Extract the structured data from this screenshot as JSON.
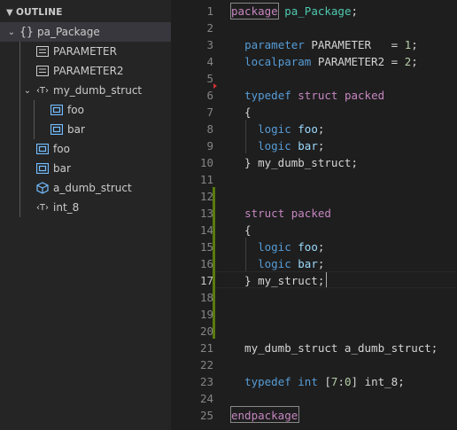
{
  "outline": {
    "title": "OUTLINE",
    "items": [
      {
        "label": "pa_Package",
        "icon": "braces-icon",
        "chevron": "expanded",
        "depth": 1,
        "selected": true
      },
      {
        "label": "PARAMETER",
        "icon": "constant-icon",
        "chevron": "none",
        "depth": 2
      },
      {
        "label": "PARAMETER2",
        "icon": "constant-icon",
        "chevron": "none",
        "depth": 2
      },
      {
        "label": "my_dumb_struct",
        "icon": "type-parameter-icon",
        "chevron": "expanded",
        "depth": 2
      },
      {
        "label": "foo",
        "icon": "variable-icon",
        "chevron": "none",
        "depth": 3
      },
      {
        "label": "bar",
        "icon": "variable-icon",
        "chevron": "none",
        "depth": 3
      },
      {
        "label": "foo",
        "icon": "variable-icon",
        "chevron": "none",
        "depth": 2
      },
      {
        "label": "bar",
        "icon": "variable-icon",
        "chevron": "none",
        "depth": 2
      },
      {
        "label": "a_dumb_struct",
        "icon": "cube-icon",
        "chevron": "none",
        "depth": 2
      },
      {
        "label": "int_8",
        "icon": "type-parameter-icon",
        "chevron": "none",
        "depth": 2
      }
    ],
    "icon_glyphs": {
      "braces": "{}",
      "type_param": "‹T›"
    }
  },
  "editor": {
    "current_line": 17,
    "lines": [
      {
        "n": "1",
        "tokens": [
          {
            "t": "package",
            "c": "kw"
          },
          {
            "t": " ",
            "c": "tx"
          },
          {
            "t": "pa_Package",
            "c": "ty"
          },
          {
            "t": ";",
            "c": "tx"
          }
        ]
      },
      {
        "n": "2",
        "tokens": []
      },
      {
        "n": "3",
        "tokens": [
          {
            "t": "  ",
            "c": "tx"
          },
          {
            "t": "parameter",
            "c": "kb"
          },
          {
            "t": " PARAMETER   = ",
            "c": "tx"
          },
          {
            "t": "1",
            "c": "nm"
          },
          {
            "t": ";",
            "c": "tx"
          }
        ]
      },
      {
        "n": "4",
        "tokens": [
          {
            "t": "  ",
            "c": "tx"
          },
          {
            "t": "localparam",
            "c": "kb"
          },
          {
            "t": " PARAMETER2 = ",
            "c": "tx"
          },
          {
            "t": "2",
            "c": "nm"
          },
          {
            "t": ";",
            "c": "tx"
          }
        ]
      },
      {
        "n": "5",
        "tokens": []
      },
      {
        "n": "6",
        "tokens": [
          {
            "t": "  ",
            "c": "tx"
          },
          {
            "t": "typedef",
            "c": "kb"
          },
          {
            "t": " ",
            "c": "tx"
          },
          {
            "t": "struct",
            "c": "kw"
          },
          {
            "t": " ",
            "c": "tx"
          },
          {
            "t": "packed",
            "c": "kw"
          }
        ]
      },
      {
        "n": "7",
        "tokens": [
          {
            "t": "  {",
            "c": "tx"
          }
        ]
      },
      {
        "n": "8",
        "tokens": [
          {
            "t": "    ",
            "c": "tx"
          },
          {
            "t": "logic",
            "c": "kb"
          },
          {
            "t": " ",
            "c": "tx"
          },
          {
            "t": "foo",
            "c": "id"
          },
          {
            "t": ";",
            "c": "tx"
          }
        ]
      },
      {
        "n": "9",
        "tokens": [
          {
            "t": "    ",
            "c": "tx"
          },
          {
            "t": "logic",
            "c": "kb"
          },
          {
            "t": " ",
            "c": "tx"
          },
          {
            "t": "bar",
            "c": "id"
          },
          {
            "t": ";",
            "c": "tx"
          }
        ]
      },
      {
        "n": "10",
        "tokens": [
          {
            "t": "  } my_dumb_struct;",
            "c": "tx"
          }
        ]
      },
      {
        "n": "11",
        "tokens": []
      },
      {
        "n": "12",
        "tokens": []
      },
      {
        "n": "13",
        "tokens": [
          {
            "t": "  ",
            "c": "tx"
          },
          {
            "t": "struct",
            "c": "kw"
          },
          {
            "t": " ",
            "c": "tx"
          },
          {
            "t": "packed",
            "c": "kw"
          }
        ]
      },
      {
        "n": "14",
        "tokens": [
          {
            "t": "  {",
            "c": "tx"
          }
        ]
      },
      {
        "n": "15",
        "tokens": [
          {
            "t": "    ",
            "c": "tx"
          },
          {
            "t": "logic",
            "c": "kb"
          },
          {
            "t": " ",
            "c": "tx"
          },
          {
            "t": "foo",
            "c": "id"
          },
          {
            "t": ";",
            "c": "tx"
          }
        ]
      },
      {
        "n": "16",
        "tokens": [
          {
            "t": "    ",
            "c": "tx"
          },
          {
            "t": "logic",
            "c": "kb"
          },
          {
            "t": " ",
            "c": "tx"
          },
          {
            "t": "bar",
            "c": "id"
          },
          {
            "t": ";",
            "c": "tx"
          }
        ]
      },
      {
        "n": "17",
        "tokens": [
          {
            "t": "  } my_struct;",
            "c": "tx"
          }
        ]
      },
      {
        "n": "18",
        "tokens": []
      },
      {
        "n": "19",
        "tokens": []
      },
      {
        "n": "20",
        "tokens": []
      },
      {
        "n": "21",
        "tokens": [
          {
            "t": "  my_dumb_struct a_dumb_struct;",
            "c": "tx"
          }
        ]
      },
      {
        "n": "22",
        "tokens": []
      },
      {
        "n": "23",
        "tokens": [
          {
            "t": "  ",
            "c": "tx"
          },
          {
            "t": "typedef",
            "c": "kb"
          },
          {
            "t": " ",
            "c": "tx"
          },
          {
            "t": "int",
            "c": "kb"
          },
          {
            "t": " [",
            "c": "tx"
          },
          {
            "t": "7",
            "c": "nm"
          },
          {
            "t": ":",
            "c": "tx"
          },
          {
            "t": "0",
            "c": "nm"
          },
          {
            "t": "] int_8;",
            "c": "tx"
          }
        ]
      },
      {
        "n": "24",
        "tokens": []
      },
      {
        "n": "25",
        "tokens": [
          {
            "t": "endpackage",
            "c": "kw"
          }
        ]
      }
    ]
  },
  "colors": {
    "keyword_control": "#c586c0",
    "keyword": "#569cd6",
    "type": "#4ec9b0",
    "variable": "#9cdcfe",
    "number": "#b5cea8",
    "modified_gutter": "#587c0c",
    "deleted_marker": "#d03030",
    "variable_icon": "#75beff",
    "cube_icon": "#75beff"
  }
}
